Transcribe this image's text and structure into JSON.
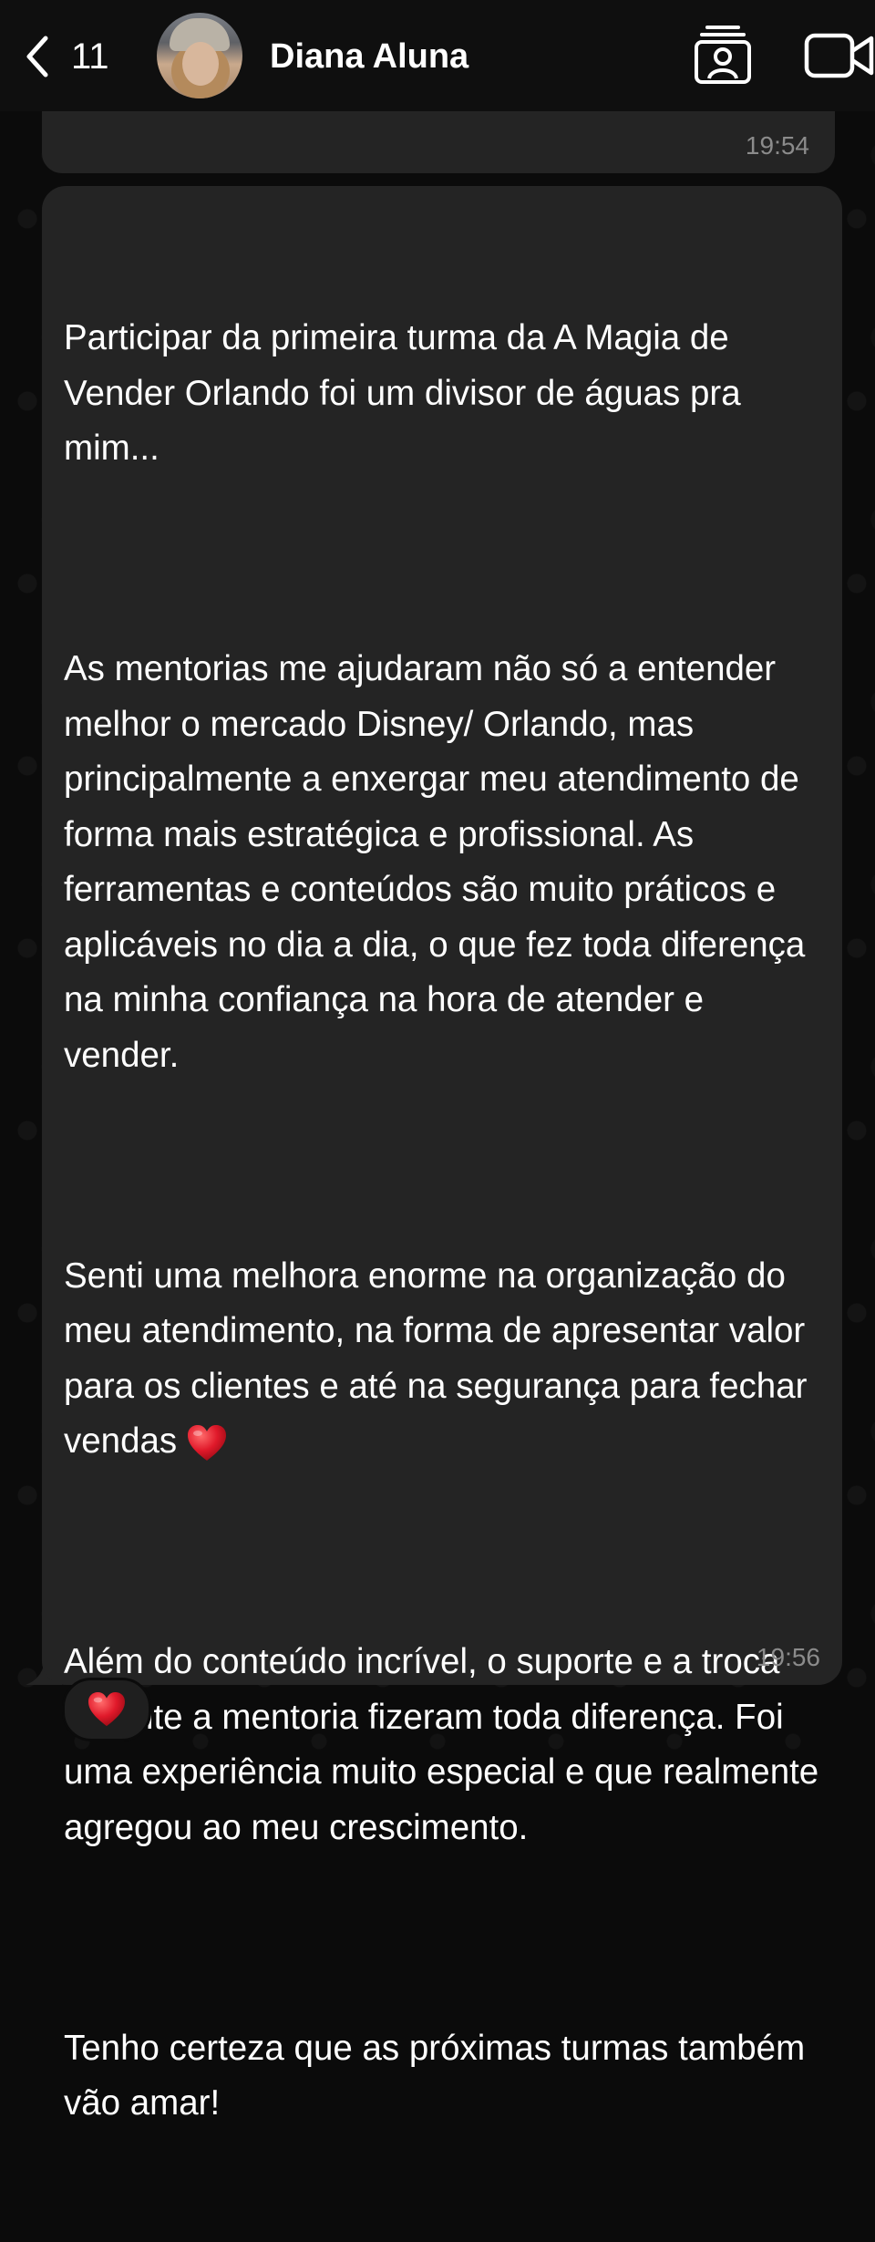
{
  "header": {
    "back_count": "11",
    "contact_name": "Diana Aluna"
  },
  "icons": {
    "back": "chevron-left-icon",
    "contact_card": "contact-card-icon",
    "video": "video-camera-icon",
    "heart": "red-heart-emoji"
  },
  "colors": {
    "background": "#0b0b0b",
    "bubble": "#242424",
    "timestamp": "#8b8b8b",
    "heart": "#e0192a"
  },
  "messages": {
    "previous": {
      "time": "19:54"
    },
    "current": {
      "paragraphs": [
        "Participar da primeira turma da A Magia de Vender Orlando foi um divisor de águas pra mim...",
        "As mentorias me ajudaram não só a entender melhor o mercado Disney/ Orlando, mas principalmente a enxergar meu atendimento de forma mais estratégica e profissional. As ferramentas e conteúdos são muito práticos e aplicáveis no dia a dia, o que fez toda diferença na minha confiança na hora de atender e vender.",
        "Senti uma melhora enorme na organização do meu atendimento, na forma de apresentar valor para os clientes e até na segurança para fechar vendas",
        "Além do conteúdo incrível, o suporte e a troca durante a mentoria fizeram toda diferença. Foi uma experiência muito especial e que realmente agregou ao meu crescimento.",
        "Tenho certeza que as próximas turmas também vão amar!"
      ],
      "time": "19:56",
      "reaction": "heart"
    }
  }
}
